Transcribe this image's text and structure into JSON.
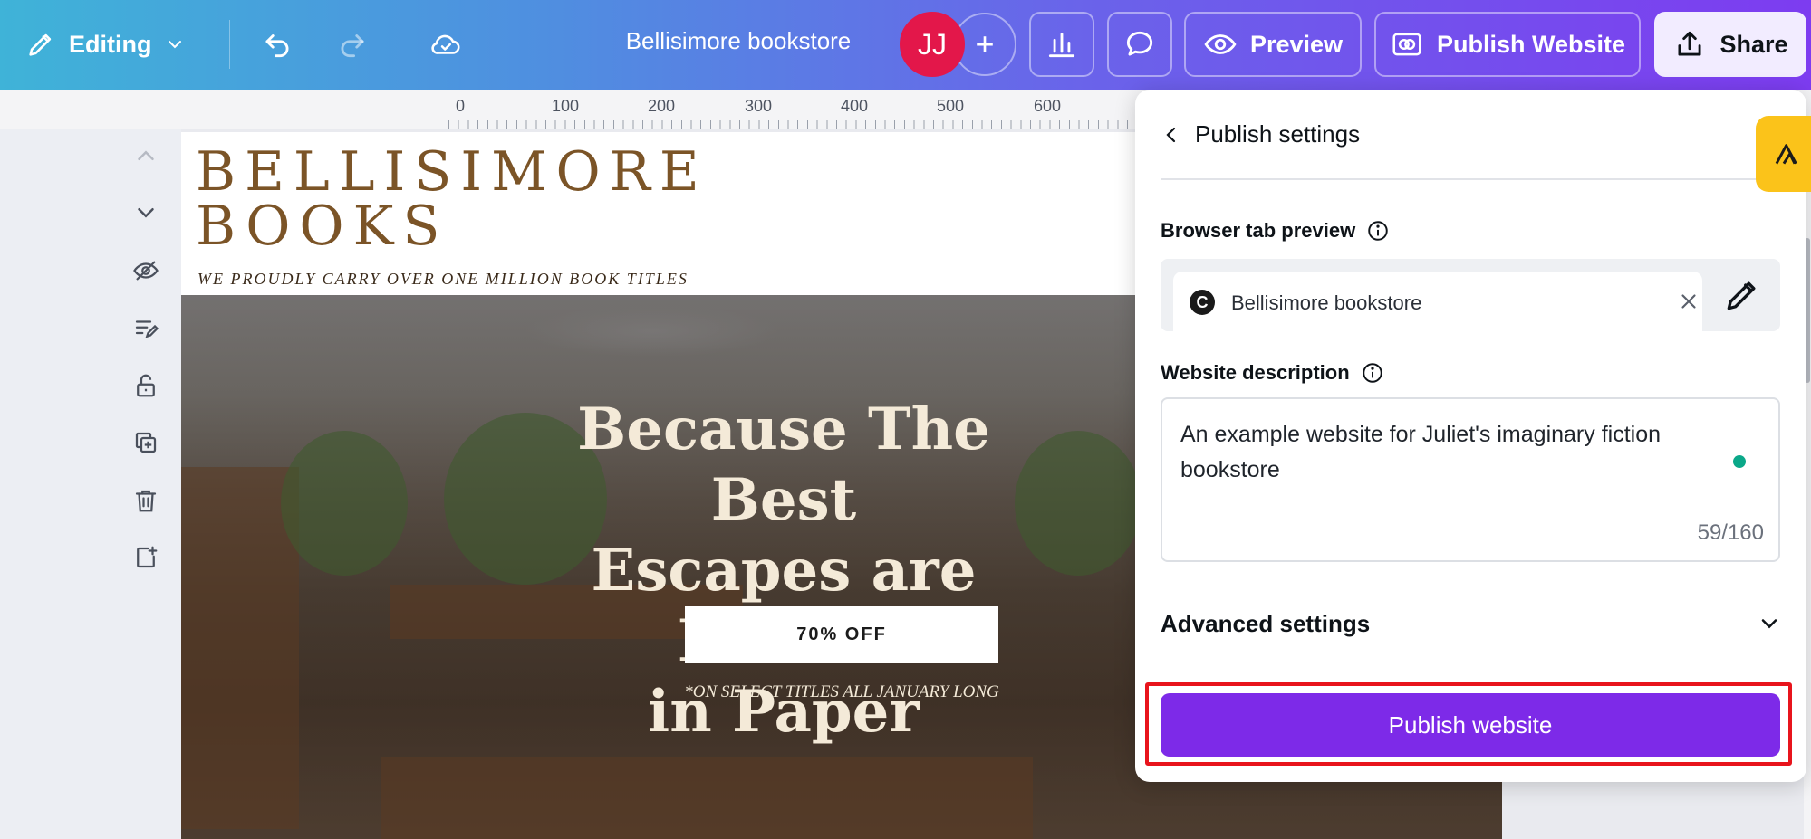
{
  "topbar": {
    "editing_label": "Editing",
    "doc_title": "Bellisimore bookstore",
    "avatar_initials": "JJ",
    "preview_label": "Preview",
    "publish_website_label": "Publish Website",
    "share_label": "Share"
  },
  "ruler": {
    "ticks": [
      "0",
      "100",
      "200",
      "300",
      "400",
      "500",
      "600"
    ]
  },
  "canvas": {
    "brand_line1": "BELLISIMORE",
    "brand_line2": "BOOKS",
    "tagline": "WE PROUDLY CARRY OVER ONE MILLION BOOK TITLES",
    "hero_line1": "Because The Best",
    "hero_line2": "Escapes are Bound",
    "hero_line3": "in Paper",
    "cta_label": "70% OFF",
    "fine_print": "*ON SELECT TITLES ALL JANUARY LONG"
  },
  "panel": {
    "header": "Publish settings",
    "browser_tab_label": "Browser tab preview",
    "tab_title": "Bellisimore bookstore",
    "favicon_letter": "C",
    "description_label": "Website description",
    "description_value": "An example website for Juliet's imaginary fiction bookstore",
    "char_count": "59/160",
    "advanced_label": "Advanced settings",
    "publish_button": "Publish website"
  },
  "colors": {
    "accent_purple": "#7d2ae8",
    "highlight_red": "#e8141c",
    "avatar_red": "#e3174a",
    "brand_brown": "#7b5427",
    "side_tab_yellow": "#fbc31a"
  }
}
